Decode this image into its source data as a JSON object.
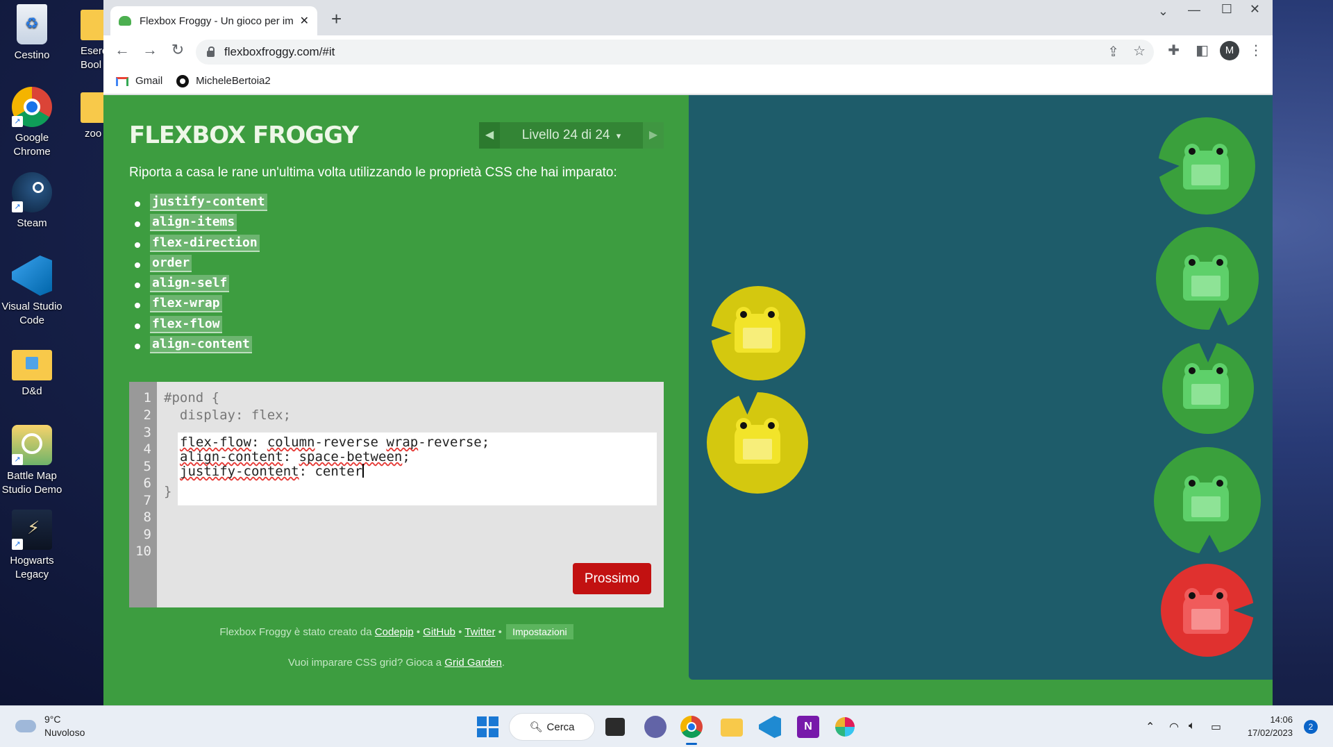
{
  "desktop": {
    "icons": [
      {
        "label": "Cestino",
        "icon": "recycle-bin-icon"
      },
      {
        "label": "Google Chrome",
        "icon": "chrome-icon"
      },
      {
        "label": "Steam",
        "icon": "steam-icon"
      },
      {
        "label": "Visual Studio Code",
        "icon": "vscode-icon"
      },
      {
        "label": "D&d",
        "icon": "folder-icon"
      },
      {
        "label": "Battle Map Studio Demo",
        "icon": "battle-map-icon"
      },
      {
        "label": "Hogwarts Legacy",
        "icon": "hogwarts-icon"
      },
      {
        "label": "Eserc Bool",
        "icon": "folder-icon"
      },
      {
        "label": "zoo",
        "icon": "folder-icon"
      }
    ]
  },
  "browser": {
    "tab_title": "Flexbox Froggy - Un gioco per im",
    "url": "flexboxfroggy.com/#it",
    "bookmarks": [
      {
        "label": "Gmail",
        "icon": "gmail-icon"
      },
      {
        "label": "MicheleBertoia2",
        "icon": "github-icon"
      }
    ],
    "profile_initial": "M"
  },
  "game": {
    "logo": "FLEXBOX FROGGY",
    "level_label": "Livello 24 di 24",
    "level_arrow": "▾",
    "intro": "Riporta a casa le rane un'ultima volta utilizzando le proprietà CSS che hai imparato:",
    "properties": [
      "justify-content",
      "align-items",
      "flex-direction",
      "order",
      "align-self",
      "flex-wrap",
      "flex-flow",
      "align-content"
    ],
    "line_numbers": [
      "1",
      "2",
      "3",
      "4",
      "5",
      "6",
      "7",
      "8",
      "9",
      "10"
    ],
    "code_before": [
      "#pond {",
      "  display: flex;"
    ],
    "code_after": "}",
    "user_input": {
      "line1_prop": "flex-flow",
      "line1_sep": ": ",
      "line1_v1": "column",
      "line1_v2": "-reverse ",
      "line1_v3": "wrap",
      "line1_v4": "-reverse;",
      "line2_prop": "align-content",
      "line2_sep": ": ",
      "line2_v1": "space-between",
      "line2_v2": ";",
      "line3_prop": "justify-content",
      "line3_sep": ": center"
    },
    "next_button": "Prossimo",
    "credits": {
      "prefix": "Flexbox Froggy è stato creato da ",
      "codepip": "Codepip",
      "sep1": " • ",
      "github": "GitHub",
      "sep2": " • ",
      "twitter": "Twitter",
      "sep3": " • ",
      "settings": "Impostazioni"
    },
    "grid_note": {
      "prefix": "Vuoi imparare CSS grid? Gioca a ",
      "link": "Grid Garden",
      "suffix": "."
    }
  },
  "taskbar": {
    "temperature": "9°C",
    "weather": "Nuvoloso",
    "search": "Cerca",
    "time": "14:06",
    "date": "17/02/2023",
    "notifications": "2"
  },
  "colors": {
    "page_green": "#3d9d40",
    "pond": "#1e5c6a",
    "frog_green": "#5ed06a",
    "frog_yellow": "#f2e42a",
    "frog_red": "#f05b5b",
    "button_red": "#c21111"
  }
}
